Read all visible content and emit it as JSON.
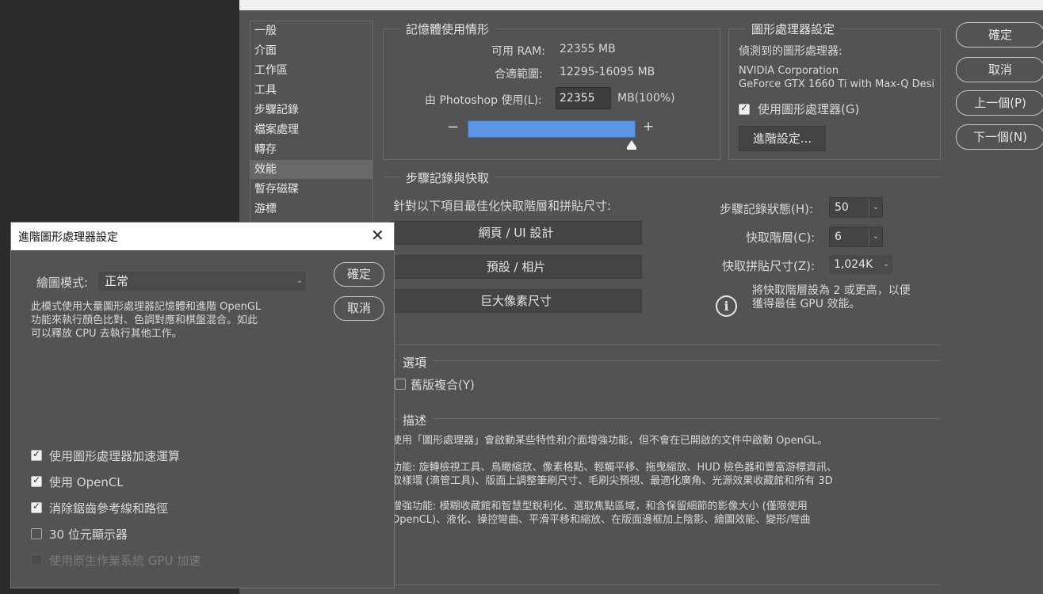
{
  "sidebar": {
    "items": [
      "一般",
      "介面",
      "工作區",
      "工具",
      "步驟記錄",
      "檔案處理",
      "轉存",
      "效能",
      "暫存磁碟",
      "游標"
    ],
    "selected_index": 7
  },
  "memory": {
    "title": "記憶體使用情形",
    "available_label": "可用 RAM:",
    "available_value": "22355 MB",
    "range_label": "合適範圍:",
    "range_value": "12295-16095 MB",
    "use_label": "由 Photoshop 使用(L):",
    "use_value": "22355",
    "use_unit": "MB(100%)",
    "minus": "−",
    "plus": "+",
    "slider_percent": 100
  },
  "gpu": {
    "title": "圖形處理器設定",
    "detected_label": "偵測到的圖形處理器:",
    "vendor": "NVIDIA Corporation",
    "model": "GeForce GTX 1660 Ti with Max-Q Desi",
    "use_gpu_label": "使用圖形處理器(G)",
    "use_gpu_checked": true,
    "advanced_button": "進階設定..."
  },
  "side_buttons": {
    "ok": "確定",
    "cancel": "取消",
    "prev": "上一個(P)",
    "next": "下一個(N)"
  },
  "history_cache": {
    "title": "步驟記錄與快取",
    "optimize_label": "針對以下項目最佳化快取階層和拼貼尺寸:",
    "preset_buttons": [
      "網頁 / UI 設計",
      "預設 / 相片",
      "巨大像素尺寸"
    ],
    "history_states_label": "步驟記錄狀態(H):",
    "history_states_value": "50",
    "cache_levels_label": "快取階層(C):",
    "cache_levels_value": "6",
    "tile_size_label": "快取拼貼尺寸(Z):",
    "tile_size_value": "1,024K",
    "info_text_1": "將快取階層設為 2 或更高，以便",
    "info_text_2": "獲得最佳 GPU 效能。",
    "info_icon": "i"
  },
  "options": {
    "title": "選項",
    "legacy_compositing_label": "舊版複合(Y)",
    "legacy_compositing_checked": false
  },
  "description": {
    "title": "描述",
    "lines": [
      "使用「圖形處理器」會啟動某些特性和介面增強功能，但不會在已開啟的文件中啟動 OpenGL。",
      "功能: 旋轉檢視工具、鳥瞰縮放、像素格點、輕觸平移、拖曳縮放、HUD 檢色器和豐富游標資訊、",
      "取樣環 (滴管工具)、版面上調整筆刷尺寸、毛刷尖預視、最適化廣角、光源效果收藏館和所有 3D",
      "增強功能: 模糊收藏館和智慧型銳利化、選取焦點區域，和含保留細節的影像大小 (僅限使用",
      "OpenCL)、液化、操控彎曲、平滑平移和縮放、在版面邊框加上陰影、繪圖效能、變形/彎曲"
    ]
  },
  "advanced_dialog": {
    "title": "進階圖形處理器設定",
    "close_icon": "close-icon",
    "draw_mode_label": "繪圖模式:",
    "draw_mode_value": "正常",
    "draw_mode_desc": [
      "此模式使用大量圖形處理器記憶體和進階 OpenGL",
      "功能來執行顏色比對、色調對應和棋盤混合。如此",
      "可以釋放 CPU 去執行其他工作。"
    ],
    "ok": "確定",
    "cancel": "取消",
    "checkboxes": [
      {
        "label": "使用圖形處理器加速運算",
        "checked": true,
        "disabled": false
      },
      {
        "label": "使用 OpenCL",
        "checked": true,
        "disabled": false
      },
      {
        "label": "消除鋸齒參考線和路徑",
        "checked": true,
        "disabled": false
      },
      {
        "label": "30 位元顯示器",
        "checked": false,
        "disabled": false
      },
      {
        "label": "使用原生作業系統 GPU 加速",
        "checked": false,
        "disabled": true
      }
    ]
  },
  "colors": {
    "panel": "#535353",
    "slider_fill": "#5b95e3",
    "selected_item": "#686868"
  }
}
